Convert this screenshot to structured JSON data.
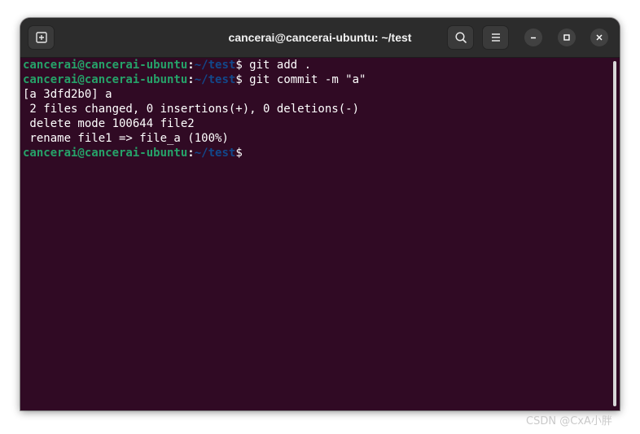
{
  "window": {
    "title": "cancerai@cancerai-ubuntu: ~/test"
  },
  "header": {
    "new_tab_icon": "new-tab-icon",
    "search_icon": "search-icon",
    "menu_icon": "hamburger-menu-icon",
    "minimize_icon": "minimize-icon",
    "maximize_icon": "maximize-icon",
    "close_icon": "close-icon"
  },
  "terminal": {
    "lines": [
      {
        "type": "prompt",
        "user": "cancerai@cancerai-ubuntu",
        "sep": ":",
        "path": "~/test",
        "symbol": "$",
        "command": " git add ."
      },
      {
        "type": "prompt",
        "user": "cancerai@cancerai-ubuntu",
        "sep": ":",
        "path": "~/test",
        "symbol": "$",
        "command": " git commit -m \"a\""
      },
      {
        "type": "output",
        "text": "[a 3dfd2b0] a"
      },
      {
        "type": "output",
        "text": " 2 files changed, 0 insertions(+), 0 deletions(-)"
      },
      {
        "type": "output",
        "text": " delete mode 100644 file2"
      },
      {
        "type": "output",
        "text": " rename file1 => file_a (100%)"
      },
      {
        "type": "prompt",
        "user": "cancerai@cancerai-ubuntu",
        "sep": ":",
        "path": "~/test",
        "symbol": "$",
        "command": ""
      }
    ]
  },
  "colors": {
    "terminal_background": "#300a24",
    "prompt_user": "#26a269",
    "prompt_path": "#12488b",
    "headerbar": "#2c2c2c"
  },
  "watermark": "CSDN @CxA小胖"
}
